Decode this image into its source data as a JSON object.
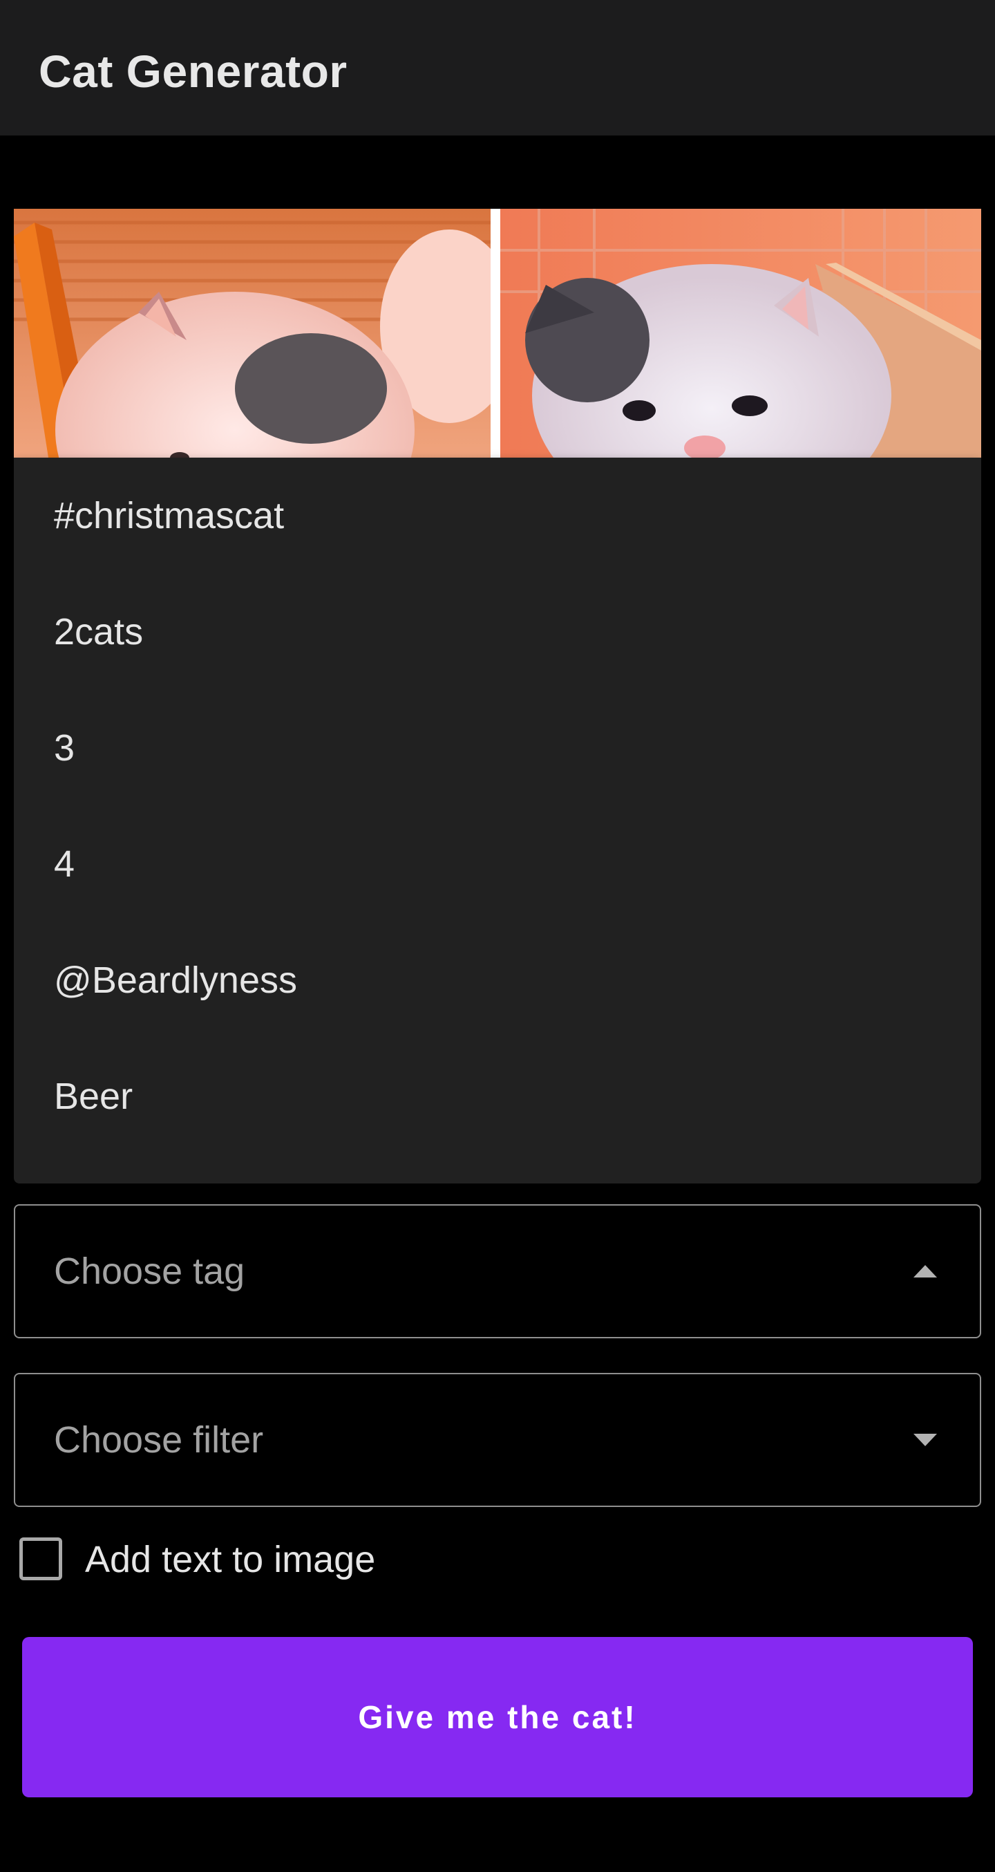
{
  "app_bar": {
    "title": "Cat Generator"
  },
  "tag_menu": {
    "items": [
      {
        "label": "#christmascat"
      },
      {
        "label": "2cats"
      },
      {
        "label": "3"
      },
      {
        "label": "4"
      },
      {
        "label": "@Beardlyness"
      },
      {
        "label": "Beer"
      }
    ]
  },
  "tag_select": {
    "placeholder": "Choose tag",
    "state": "open",
    "icon": "arrow-up-icon"
  },
  "filter_select": {
    "placeholder": "Choose filter",
    "state": "closed",
    "icon": "arrow-down-icon"
  },
  "add_text": {
    "label": "Add text to image",
    "checked": false
  },
  "generate_button": {
    "label": "Give me the cat!"
  },
  "colors": {
    "background": "#000000",
    "app_bar": "#1c1c1d",
    "menu": "#212121",
    "accent": "#8629f2",
    "text": "#e6e6e6",
    "placeholder": "#a3a3a3"
  }
}
